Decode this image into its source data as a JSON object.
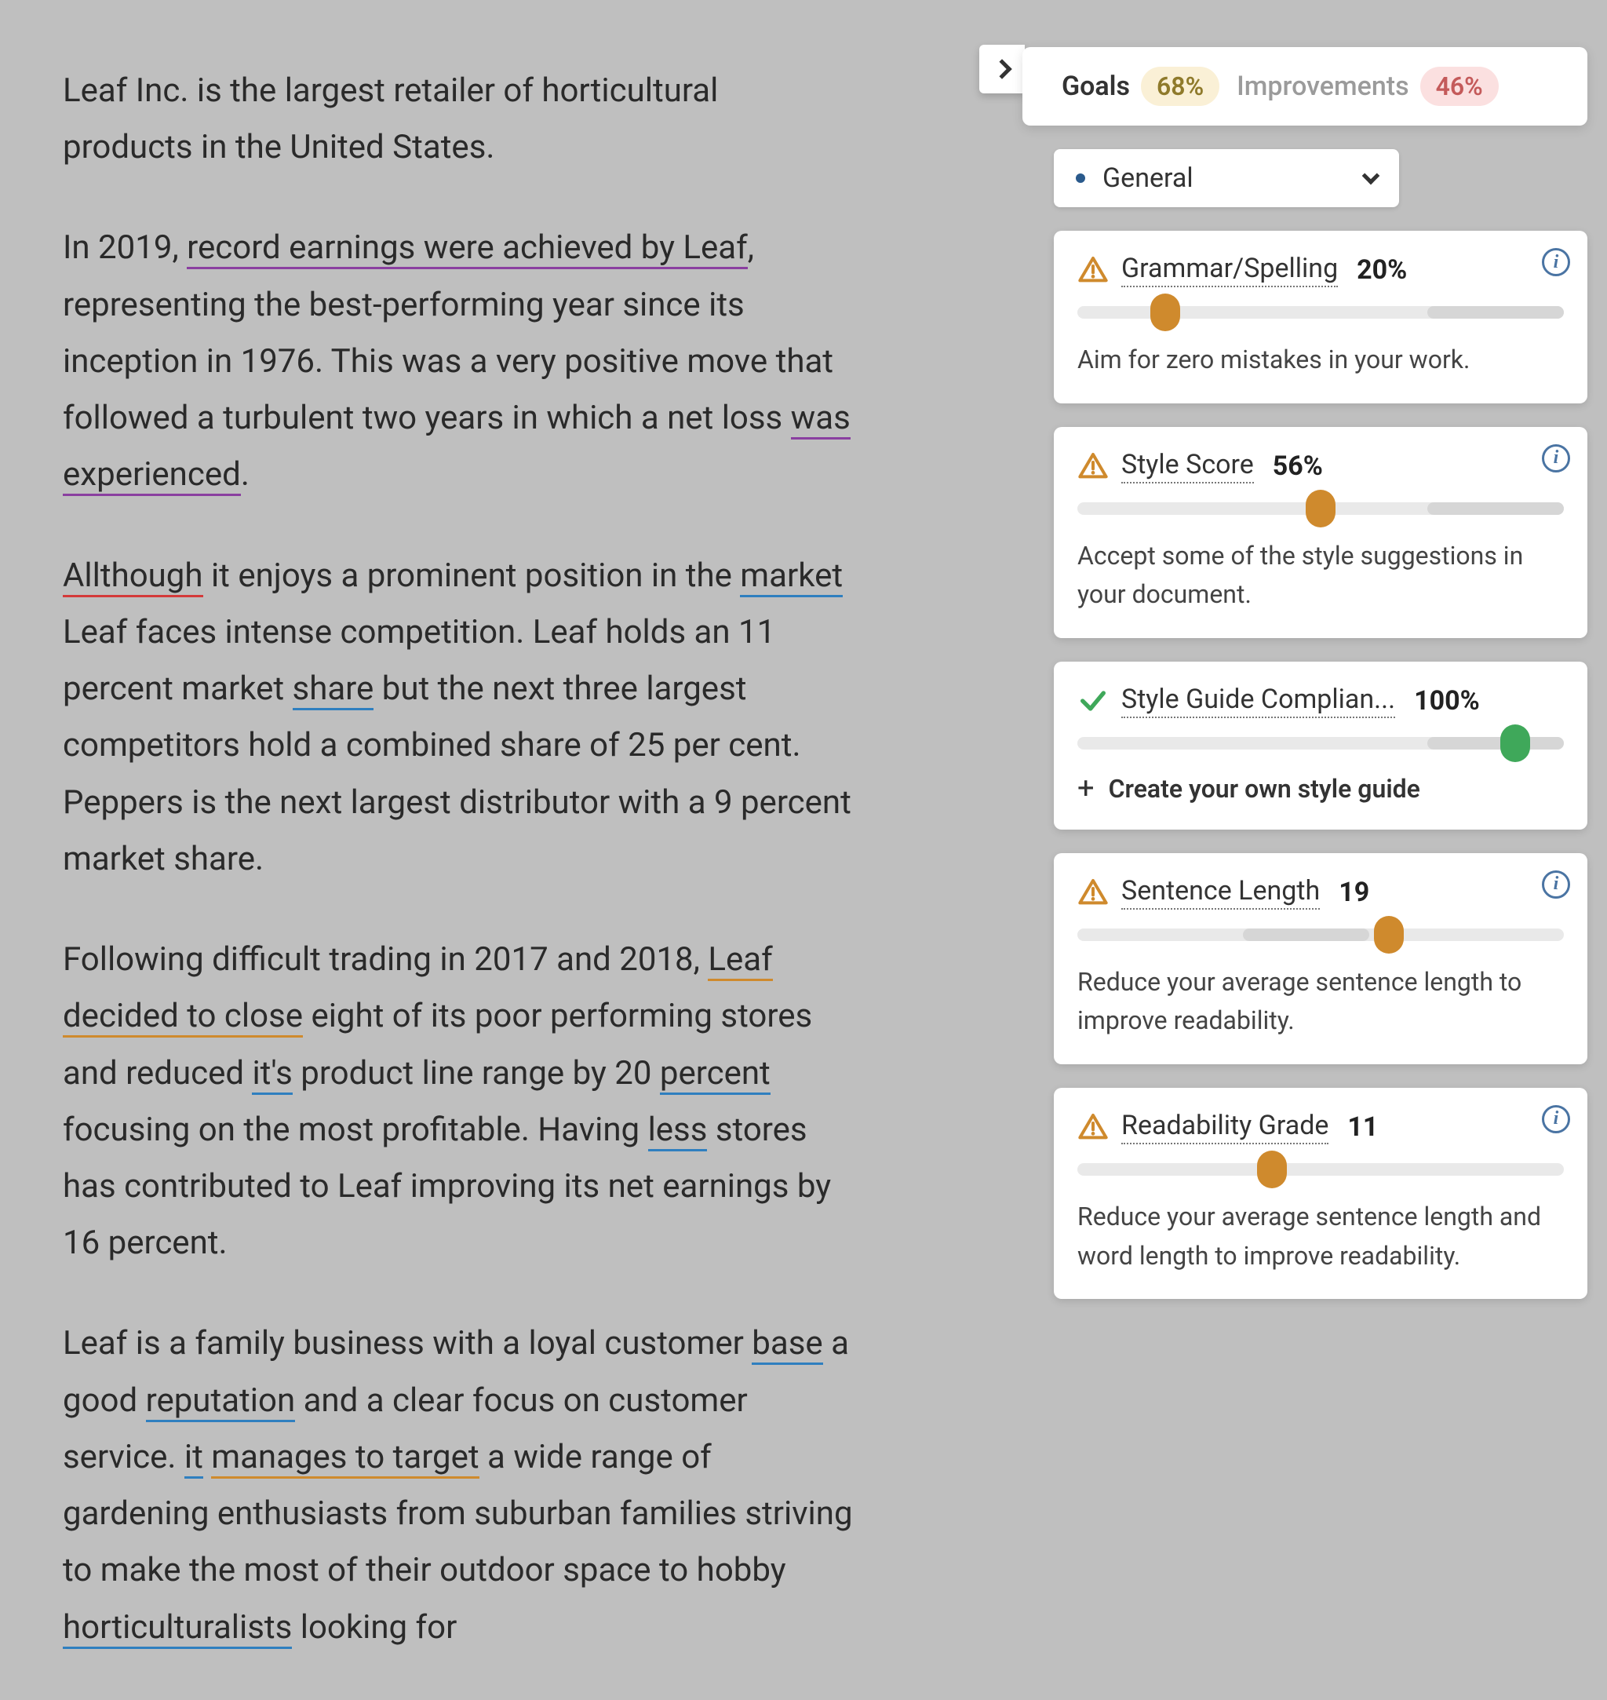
{
  "document": {
    "paragraphs": [
      {
        "runs": [
          {
            "text": "Leaf Inc. is the largest retailer of horticultural products in the United States."
          }
        ]
      },
      {
        "runs": [
          {
            "text": "In 2019, "
          },
          {
            "text": "record earnings were achieved by Leaf",
            "u": "purple"
          },
          {
            "text": ", representing the best-performing year since its inception in 1976. This was a very positive move that followed a turbulent two years in which a net loss "
          },
          {
            "text": "was experienced",
            "u": "purple"
          },
          {
            "text": "."
          }
        ]
      },
      {
        "runs": [
          {
            "text": "Allthough",
            "u": "red"
          },
          {
            "text": " it enjoys a prominent position in the "
          },
          {
            "text": "market",
            "u": "blue"
          },
          {
            "text": " Leaf faces intense competition. Leaf holds an 11 percent market "
          },
          {
            "text": "share",
            "u": "blue"
          },
          {
            "text": " but the next three largest competitors hold a combined share of 25 per cent. Peppers is the next largest distributor with a 9 percent market share."
          }
        ]
      },
      {
        "runs": [
          {
            "text": "Following difficult trading in 2017 and 2018, "
          },
          {
            "text": "Leaf decided to close",
            "u": "orange"
          },
          {
            "text": " eight of its poor performing stores and reduced "
          },
          {
            "text": "it's",
            "u": "blue"
          },
          {
            "text": " product line range by 20 "
          },
          {
            "text": "percent",
            "u": "blue"
          },
          {
            "text": " focusing on the most profitable. Having "
          },
          {
            "text": "less",
            "u": "blue"
          },
          {
            "text": " stores has contributed to Leaf improving its net earnings by 16 percent."
          }
        ]
      },
      {
        "runs": [
          {
            "text": "Leaf is a family business with a loyal customer "
          },
          {
            "text": "base",
            "u": "blue"
          },
          {
            "text": " a good "
          },
          {
            "text": "reputation",
            "u": "blue"
          },
          {
            "text": " and a clear focus on customer service. "
          },
          {
            "text": "it",
            "u": "blue"
          },
          {
            "text": " "
          },
          {
            "text": "manages to target",
            "u": "orange"
          },
          {
            "text": " a wide range of gardening enthusiasts from suburban families striving to make the most of their outdoor space to hobby "
          },
          {
            "text": "horticulturalists",
            "u": "blue"
          },
          {
            "text": " looking for"
          }
        ]
      }
    ]
  },
  "panel": {
    "tabs": {
      "goals": {
        "label": "Goals",
        "badge": "68%"
      },
      "improvements": {
        "label": "Improvements",
        "badge": "46%"
      }
    },
    "category": {
      "label": "General"
    },
    "info_glyph": "i",
    "cards": [
      {
        "id": "grammar",
        "status": "warn",
        "title": "Grammar/Spelling",
        "score": "20%",
        "thumb_pct": 18,
        "thumb_color": "orange",
        "zone_start": 72,
        "zone_end": 100,
        "desc": "Aim for zero mistakes in your work.",
        "show_info": true
      },
      {
        "id": "style",
        "status": "warn",
        "title": "Style Score",
        "score": "56%",
        "thumb_pct": 50,
        "thumb_color": "orange",
        "zone_start": 72,
        "zone_end": 100,
        "desc": "Accept some of the style suggestions in your document.",
        "show_info": true
      },
      {
        "id": "styleguide",
        "status": "ok",
        "title": "Style Guide Complian...",
        "score": "100%",
        "thumb_pct": 90,
        "thumb_color": "green",
        "zone_start": 72,
        "zone_end": 100,
        "action": "Create your own style guide",
        "show_info": false
      },
      {
        "id": "sentence",
        "status": "warn",
        "title": "Sentence Length",
        "score": "19",
        "thumb_pct": 64,
        "thumb_color": "orange",
        "zone_start": 34,
        "zone_end": 60,
        "desc": "Reduce your average sentence length to improve readability.",
        "show_info": true
      },
      {
        "id": "readability",
        "status": "warn",
        "title": "Readability Grade",
        "score": "11",
        "thumb_pct": 40,
        "thumb_color": "orange",
        "zone_start": 0,
        "zone_end": 0,
        "desc": "Reduce your average sentence length and word length to improve readability.",
        "show_info": true
      }
    ]
  }
}
